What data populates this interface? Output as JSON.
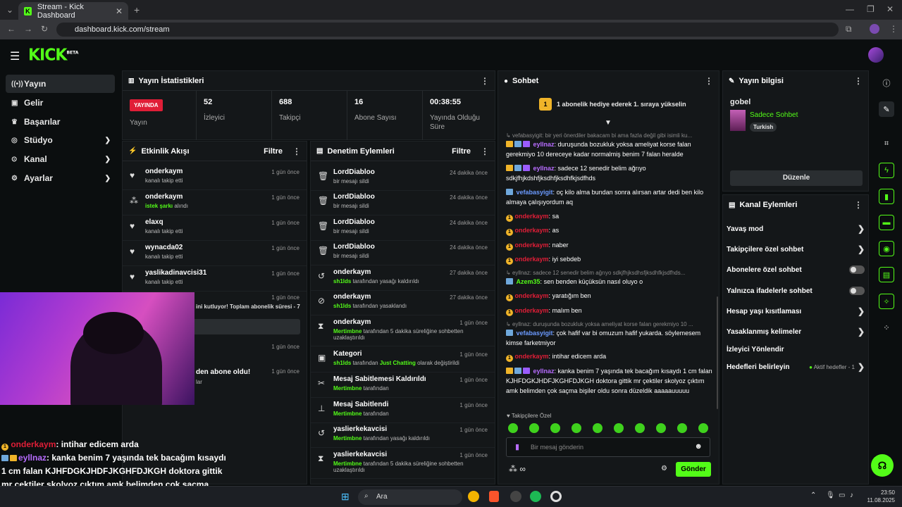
{
  "browser": {
    "tab_title": "Stream - Kick Dashboard",
    "url": "dashboard.kick.com/stream"
  },
  "brand": {
    "logo": "KICK",
    "logo_sup": "BETA",
    "accent": "#53fc18"
  },
  "sidebar": {
    "items": [
      {
        "label": "Yayın",
        "icon": "broadcast-icon"
      },
      {
        "label": "Gelir",
        "icon": "money-icon"
      },
      {
        "label": "Başarılar",
        "icon": "trophy-icon"
      },
      {
        "label": "Stüdyo",
        "icon": "studio-icon"
      },
      {
        "label": "Kanal",
        "icon": "channel-icon"
      },
      {
        "label": "Ayarlar",
        "icon": "gear-icon"
      }
    ]
  },
  "stats": {
    "title": "Yayın İstatistikleri",
    "live_badge": "YAYINDA",
    "live_label": "Yayın",
    "items": [
      {
        "value": "52",
        "label": "İzleyici"
      },
      {
        "value": "688",
        "label": "Takipçi"
      },
      {
        "value": "16",
        "label": "Abone Sayısı"
      },
      {
        "value": "00:38:55",
        "label": "Yayında Olduğu Süre"
      }
    ]
  },
  "activity": {
    "title": "Etkinlik Akışı",
    "filter": "Filtre",
    "events": [
      {
        "name": "onderkaym",
        "desc": "kanalı takip etti",
        "time": "1 gün önce"
      },
      {
        "name": "onderkaym",
        "desc_hl": "istek şarkı",
        "desc_rest": " alındı",
        "time": "1 gün önce"
      },
      {
        "name": "elaxq",
        "desc": "kanalı takip etti",
        "time": "1 gün önce"
      },
      {
        "name": "wynacda02",
        "desc": "kanalı takip etti",
        "time": "1 gün önce"
      },
      {
        "name": "yaslikadinavcisi31",
        "desc": "kanalı takip etti",
        "time": "1 gün önce"
      }
    ],
    "hidden_rows": [
      {
        "time": "1 gün önce",
        "text": "ini kutluyor! Toplam abonelik süresi - 7"
      },
      {
        "time": "1 gün önce",
        "text": ""
      },
      {
        "time": "1 gün önce",
        "text": "den abone oldu!"
      }
    ],
    "hidden_sub": "lar"
  },
  "moderation": {
    "title": "Denetim Eylemleri",
    "filter": "Filtre",
    "events": [
      {
        "name": "LordDiabloo",
        "desc": "bir mesajı sildi",
        "time": "24 dakika önce"
      },
      {
        "name": "LordDiabloo",
        "desc": "bir mesajı sildi",
        "time": "24 dakika önce"
      },
      {
        "name": "LordDiabloo",
        "desc": "bir mesajı sildi",
        "time": "24 dakika önce"
      },
      {
        "name": "LordDiabloo",
        "desc": "bir mesajı sildi",
        "time": "24 dakika önce"
      },
      {
        "name": "onderkaym",
        "hl": "sh1lds",
        "desc": " tarafından yasağı kaldırıldı",
        "time": "27 dakika önce"
      },
      {
        "name": "onderkaym",
        "hl": "sh1lds",
        "desc": " tarafından yasaklandı",
        "time": "27 dakika önce"
      },
      {
        "name": "onderkaym",
        "hl": "Mertimbne",
        "desc": " tarafından 5 dakika süreliğine sohbetten uzaklaştırıldı",
        "time": "1 gün önce"
      },
      {
        "name": "Kategori",
        "hl": "sh1lds",
        "desc": " tarafından ",
        "hl2": "Just Chatting",
        "desc2": " olarak değiştirildi",
        "time": "1 gün önce"
      },
      {
        "name": "Mesaj Sabitlemesi Kaldırıldı",
        "hl": "Mertimbne",
        "desc": " tarafından",
        "time": "1 gün önce"
      },
      {
        "name": "Mesaj Sabitlendi",
        "hl": "Mertimbne",
        "desc": " tarafından",
        "time": "1 gün önce"
      },
      {
        "name": "yaslierkekavcisi",
        "hl": "Mertimbne",
        "desc": " tarafından yasağı kaldırıldı",
        "time": "1 gün önce"
      },
      {
        "name": "yaslierkekavcisi",
        "hl": "Mertimbne",
        "desc": " tarafından 5 dakika süreliğine sohbetten uzaklaştırıldı",
        "time": "1 gün önce"
      }
    ]
  },
  "chat": {
    "title": "Sohbet",
    "pinned_rank": "1",
    "pinned": "1 abonelik hediye ederek 1. sıraya yükselin",
    "messages": [
      {
        "type": "grey",
        "text": "vefabasyigit: bir yeri önerdiler bakacam bi ama fazla değil gibi isimli ku..."
      },
      {
        "user": "eyllnaz",
        "cls": "u-pur",
        "badges": "gsb",
        "text": "duruşunda bozukluk yoksa ameliyat korse falan gerekmiyo 10 dereceye kadar normalmiş benim 7 falan heralde"
      },
      {
        "user": "eyllnaz",
        "cls": "u-pur",
        "badges": "gsb",
        "text": "sadece 12 senedir belim ağrıyo sdkjfhjkdshfjksdhfjksdhfkjsdfhds"
      },
      {
        "user": "vefabasyigit",
        "cls": "u-blu",
        "badges": "b",
        "text": "oç kilo alma bundan sonra alırsan artar dedi ben kilo almaya çalışıyordum aq"
      },
      {
        "user": "onderkaym",
        "cls": "u-red",
        "badges": "1",
        "text": "sa"
      },
      {
        "user": "onderkaym",
        "cls": "u-red",
        "badges": "1",
        "text": "as"
      },
      {
        "user": "onderkaym",
        "cls": "u-red",
        "badges": "1",
        "text": "naber"
      },
      {
        "user": "onderkaym",
        "cls": "u-red",
        "badges": "1",
        "text": "iyi sebdeb"
      },
      {
        "type": "grey",
        "text": "eyllnaz: sadece 12 senedir belim ağrıyo sdkjfhjksdhsfjksdhfkjsdfhds..."
      },
      {
        "user": "Azem35",
        "cls": "u-grn",
        "badges": "b",
        "text": "sen benden küçüksün nasıl oluyo o"
      },
      {
        "user": "onderkaym",
        "cls": "u-red",
        "badges": "1",
        "text": "yaratığım ben"
      },
      {
        "user": "onderkaym",
        "cls": "u-red",
        "badges": "1",
        "text": "malım ben"
      },
      {
        "type": "grey",
        "text": "eyllnaz: duruşunda bozukluk yoksa ameliyat korse falan gerekmiyo 10 ..."
      },
      {
        "user": "vefabasyigit",
        "cls": "u-blu",
        "badges": "b",
        "text": "çok hafif var bi omuzum hafif yukarda. söylemesem kimse farketmiyor"
      },
      {
        "user": "onderkaym",
        "cls": "u-red",
        "badges": "1",
        "text": "intihar edicem arda"
      },
      {
        "user": "eyllnaz",
        "cls": "u-pur",
        "badges": "gsb",
        "text": "kanka benim 7 yaşında tek bacağım kısaydı 1 cm falan KJHFDGKJHDFJKGHFDJKGH doktora gittik mr çektiler skolyoz çıktım amk belimden çok saçma bişiler oldu sonra düzeldik aaaaauuuuu"
      }
    ],
    "mode": "Takipçilere Özel",
    "input_placeholder": "Bir mesaj gönderin",
    "send": "Gönder"
  },
  "stream_info": {
    "title": "Yayın bilgisi",
    "stream_title": "gobel",
    "category": "Sadece Sohbet",
    "tag": "Turkish",
    "edit": "Düzenle"
  },
  "channel_actions": {
    "title": "Kanal Eylemleri",
    "items": [
      {
        "label": "Yavaş mod",
        "ctrl": "chevron"
      },
      {
        "label": "Takipçilere özel sohbet",
        "ctrl": "chevron"
      },
      {
        "label": "Abonelere özel sohbet",
        "ctrl": "toggle"
      },
      {
        "label": "Yalnızca ifadelerle sohbet",
        "ctrl": "toggle"
      },
      {
        "label": "Hesap yaşı kısıtlaması",
        "ctrl": "chevron"
      },
      {
        "label": "Yasaklanmış kelimeler",
        "ctrl": "chevron"
      },
      {
        "label": "İzleyici Yönlendir",
        "ctrl": "none"
      },
      {
        "label": "Hedefleri belirleyin",
        "ctrl": "goal",
        "extra": "Aktif hedefler - 1"
      }
    ]
  },
  "overlay_chat": [
    {
      "user": "onderkaym",
      "text": ": intihar edicem arda"
    },
    {
      "user": "eyllnaz",
      "text": ": kanka benim 7 yaşında tek bacağım kısaydı 1 cm falan KJHFDGKJHDFJKGHFDJKGH doktora gittik mr çektiler skolyoz çıktım amk belimden çok saçma bişiler oldu sonra düzeldik aaaaauuuuuu"
    }
  ],
  "taskbar": {
    "search": "Ara",
    "time": "23:50",
    "date": "11.08.2025"
  }
}
